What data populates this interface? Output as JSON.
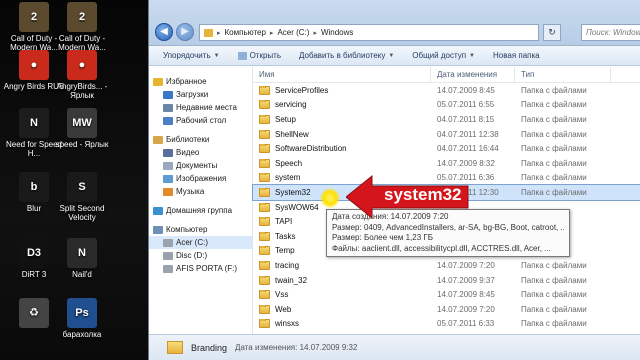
{
  "desktop": {
    "icons": [
      {
        "label": "Call of Duty - Modern Wa...",
        "icon": "call-of-duty-icon",
        "color": "#5b4a2e",
        "glyph": "2"
      },
      {
        "label": "Call of Duty - Modern Wa...",
        "icon": "call-of-duty-icon",
        "color": "#5b4a2e",
        "glyph": "2"
      },
      {
        "label": "Angry Birds RUS",
        "icon": "angry-birds-icon",
        "color": "#c92a1c",
        "glyph": "●"
      },
      {
        "label": "AngryBirds... - Ярлык",
        "icon": "angry-birds-icon",
        "color": "#c92a1c",
        "glyph": "●"
      },
      {
        "label": "Need for Speed H...",
        "icon": "need-for-speed-icon",
        "color": "#1d1d1d",
        "glyph": "N"
      },
      {
        "label": "speed - Ярлык",
        "icon": "most-wanted-icon",
        "color": "#3a3a3a",
        "glyph": "MW"
      },
      {
        "label": "Blur",
        "icon": "blur-icon",
        "color": "#1a1a1a",
        "glyph": "b"
      },
      {
        "label": "Split Second Velocity",
        "icon": "split-second-icon",
        "color": "#1a1a1a",
        "glyph": "S"
      },
      {
        "label": "DiRT 3",
        "icon": "dirt3-icon",
        "color": "#111",
        "glyph": "D3"
      },
      {
        "label": "Nail'd",
        "icon": "naild-icon",
        "color": "#2a2a2a",
        "glyph": "N"
      },
      {
        "label": "",
        "icon": "recycle-bin-icon",
        "color": "#444",
        "glyph": "♻"
      },
      {
        "label": "барахолка",
        "icon": "photoshop-icon",
        "color": "#1f4f8f",
        "glyph": "Ps"
      }
    ]
  },
  "window": {
    "address": [
      "Компьютер",
      "Acer (C:)",
      "Windows"
    ],
    "search_placeholder": "Поиск: Windows",
    "toolbar": {
      "organize": "Упорядочить",
      "open": "Открыть",
      "add_to_library": "Добавить в библиотеку",
      "share": "Общий доступ",
      "new_folder": "Новая папка"
    },
    "nav": [
      {
        "label": "Избранное",
        "group": true,
        "icon": "star-icon",
        "color": "#e8b530"
      },
      {
        "label": "Загрузки",
        "group": false,
        "icon": "downloads-icon",
        "color": "#3b78c8"
      },
      {
        "label": "Недавние места",
        "group": false,
        "icon": "recent-places-icon",
        "color": "#6a86a8"
      },
      {
        "label": "Рабочий стол",
        "group": false,
        "icon": "desktop-icon",
        "color": "#4b7fc4"
      },
      {
        "label": "Библиотеки",
        "group": true,
        "icon": "libraries-icon",
        "color": "#d7a64a"
      },
      {
        "label": "Видео",
        "group": false,
        "icon": "video-icon",
        "color": "#5a6fa0"
      },
      {
        "label": "Документы",
        "group": false,
        "icon": "documents-icon",
        "color": "#9aa9bd"
      },
      {
        "label": "Изображения",
        "group": false,
        "icon": "pictures-icon",
        "color": "#5f9bd5"
      },
      {
        "label": "Музыка",
        "group": false,
        "icon": "music-icon",
        "color": "#e08a2b"
      },
      {
        "label": "Домашняя группа",
        "group": true,
        "icon": "homegroup-icon",
        "color": "#3a8fd1"
      },
      {
        "label": "Компьютер",
        "group": true,
        "icon": "computer-icon",
        "color": "#6f8fb5"
      },
      {
        "label": "Acer (C:)",
        "group": false,
        "icon": "drive-c-icon",
        "color": "#9aa3ad",
        "selected": true
      },
      {
        "label": "Disc (D:)",
        "group": false,
        "icon": "drive-d-icon",
        "color": "#9aa3ad"
      },
      {
        "label": "AFIS PORTA (F:)",
        "group": false,
        "icon": "drive-f-icon",
        "color": "#9aa3ad"
      }
    ],
    "columns": {
      "name": "Имя",
      "date": "Дата изменения",
      "type": "Тип"
    },
    "files": [
      {
        "name": "ServiceProfiles",
        "date": "14.07.2009 8:45",
        "type": "Папка с файлами"
      },
      {
        "name": "servicing",
        "date": "05.07.2011 6:55",
        "type": "Папка с файлами"
      },
      {
        "name": "Setup",
        "date": "04.07.2011 8:15",
        "type": "Папка с файлами"
      },
      {
        "name": "ShellNew",
        "date": "04.07.2011 12:38",
        "type": "Папка с файлами"
      },
      {
        "name": "SoftwareDistribution",
        "date": "04.07.2011 16:44",
        "type": "Папка с файлами"
      },
      {
        "name": "Speech",
        "date": "14.07.2009 8:32",
        "type": "Папка с файлами"
      },
      {
        "name": "system",
        "date": "05.07.2011 6:36",
        "type": "Папка с файлами"
      },
      {
        "name": "System32",
        "date": "05.07.2011 12:30",
        "type": "Папка с файлами",
        "selected": true
      },
      {
        "name": "SysWOW64",
        "date": "",
        "type": ""
      },
      {
        "name": "TAPI",
        "date": "",
        "type": ""
      },
      {
        "name": "Tasks",
        "date": "",
        "type": ""
      },
      {
        "name": "Temp",
        "date": "",
        "type": ""
      },
      {
        "name": "tracing",
        "date": "14.07.2009 7:20",
        "type": "Папка с файлами"
      },
      {
        "name": "twain_32",
        "date": "14.07.2009 9:37",
        "type": "Папка с файлами"
      },
      {
        "name": "Vss",
        "date": "14.07.2009 8:45",
        "type": "Папка с файлами"
      },
      {
        "name": "Web",
        "date": "14.07.2009 7:20",
        "type": "Папка с файлами"
      },
      {
        "name": "winsxs",
        "date": "05.07.2011 6:33",
        "type": "Папка с файлами"
      }
    ],
    "tooltip": [
      "Дата создания: 14.07.2009 7:20",
      "Размер: 0409, AdvancedInstallers, ar-SA, bg-BG, Boot, catroot, ...",
      "Размер: Более чем 1,23 ГБ",
      "Файлы: aaclient.dll, accessibilitycpl.dll, ACCTRES.dll, Acer, ..."
    ],
    "status": {
      "name": "Branding",
      "detail": "Дата изменения: 14.07.2009 9:32"
    }
  },
  "callout": {
    "label": "system32",
    "color": "#d4161c"
  }
}
